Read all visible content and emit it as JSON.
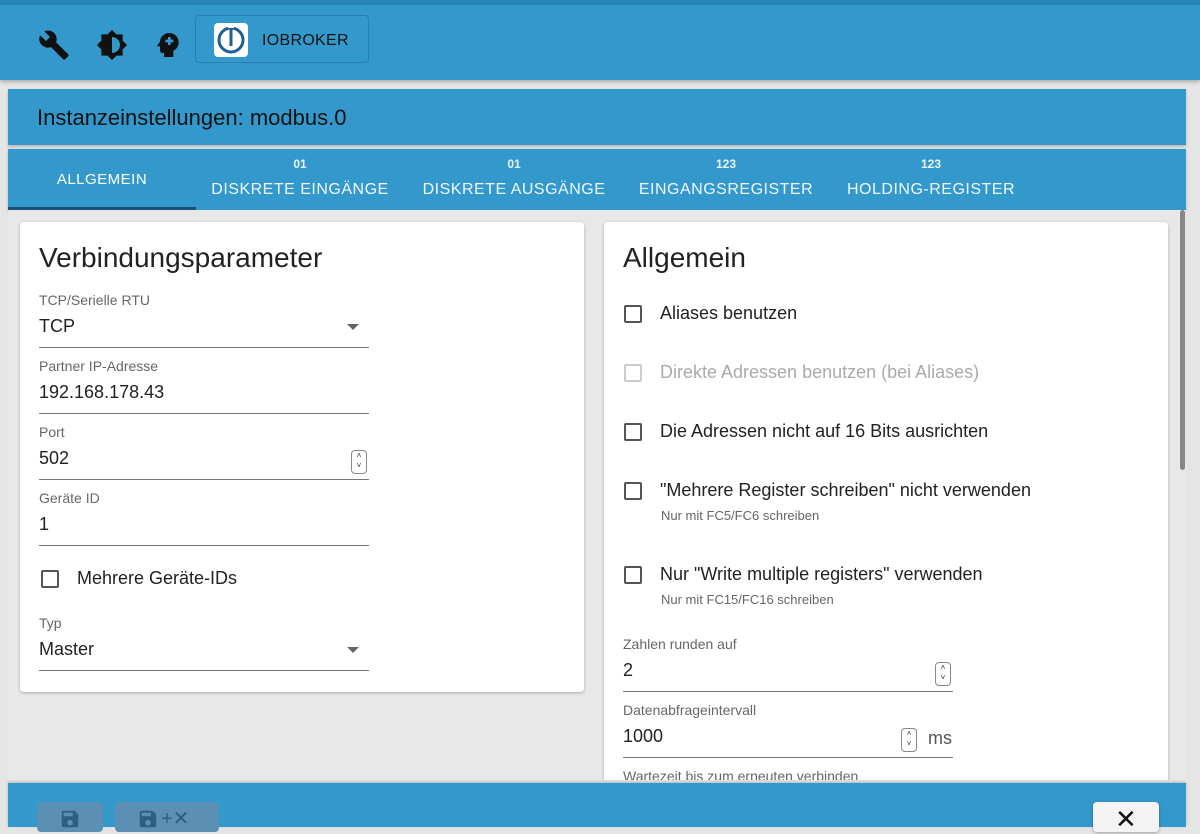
{
  "app": {
    "brand_label": "IOBROKER"
  },
  "page": {
    "title": "Instanzeinstellungen: modbus.0"
  },
  "tabs": [
    {
      "icon": "",
      "label": "ALLGEMEIN",
      "active": true
    },
    {
      "icon": "01",
      "label": "DISKRETE EINGÄNGE"
    },
    {
      "icon": "01",
      "label": "DISKRETE AUSGÄNGE"
    },
    {
      "icon": "123",
      "label": "EINGANGSREGISTER"
    },
    {
      "icon": "123",
      "label": "HOLDING-REGISTER"
    }
  ],
  "connection": {
    "title": "Verbindungsparameter",
    "mode": {
      "label": "TCP/Serielle RTU",
      "value": "TCP"
    },
    "ip": {
      "label": "Partner IP-Adresse",
      "value": "192.168.178.43"
    },
    "port": {
      "label": "Port",
      "value": "502"
    },
    "device_id": {
      "label": "Geräte ID",
      "value": "1"
    },
    "multi_ids": {
      "label": "Mehrere Geräte-IDs",
      "checked": false
    },
    "type": {
      "label": "Typ",
      "value": "Master"
    }
  },
  "general": {
    "title": "Allgemein",
    "options": [
      {
        "label": "Aliases benutzen",
        "checked": false,
        "disabled": false,
        "help": ""
      },
      {
        "label": "Direkte Adressen benutzen (bei Aliases)",
        "checked": false,
        "disabled": true,
        "help": ""
      },
      {
        "label": "Die Adressen nicht auf 16 Bits ausrichten",
        "checked": false,
        "disabled": false,
        "help": ""
      },
      {
        "label": "\"Mehrere Register schreiben\" nicht verwenden",
        "checked": false,
        "disabled": false,
        "help": "Nur mit FC5/FC6 schreiben"
      },
      {
        "label": "Nur \"Write multiple registers\" verwenden",
        "checked": false,
        "disabled": false,
        "help": "Nur mit FC15/FC16 schreiben"
      }
    ],
    "round": {
      "label": "Zahlen runden auf",
      "value": "2"
    },
    "poll": {
      "label": "Datenabfrageintervall",
      "value": "1000",
      "unit": "ms"
    },
    "reconnect": {
      "label": "Wartezeit bis zum erneuten verbinden"
    }
  },
  "footer": {
    "close_symbol": "✕"
  }
}
